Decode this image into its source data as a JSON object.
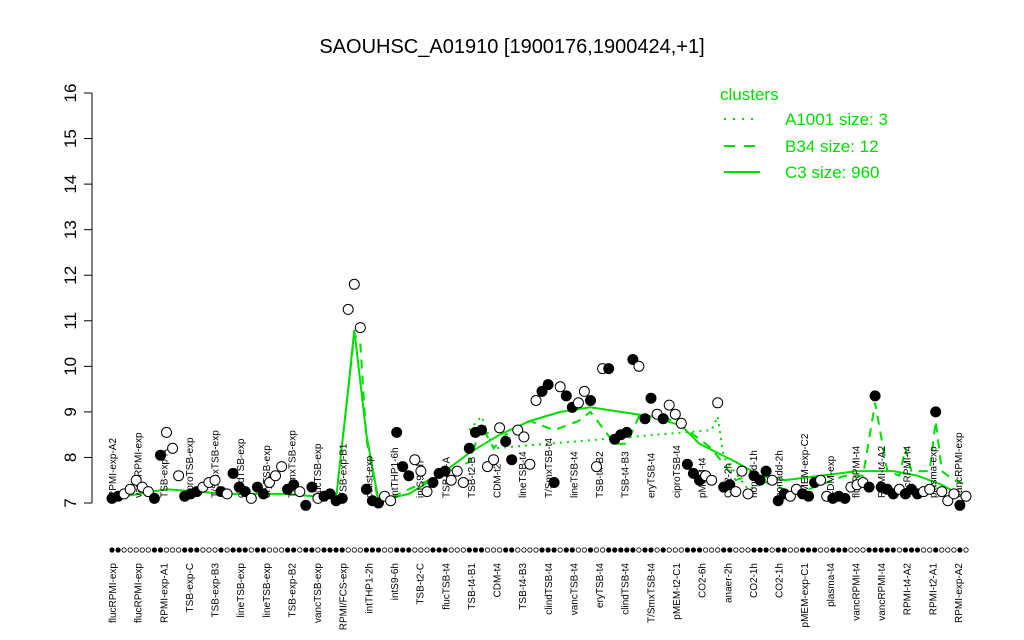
{
  "chart_data": {
    "type": "scatter",
    "title": "SAOUHSC_A01910 [1900176,1900424,+1]",
    "xlabel": "",
    "ylabel": "",
    "ylim": [
      7,
      16
    ],
    "yticks": [
      7,
      8,
      9,
      10,
      11,
      12,
      13,
      14,
      15,
      16
    ],
    "grid": false,
    "legend": {
      "title": "clusters",
      "position": "top-right",
      "entries": [
        {
          "label": "A1001 size: 3",
          "style": "dotted"
        },
        {
          "label": "B34 size: 12",
          "style": "dashed"
        },
        {
          "label": "C3 size: 960",
          "style": "solid"
        }
      ]
    },
    "colors": {
      "cluster_line": "#00dd00",
      "points": "#000000"
    },
    "x_tick_labels": [
      "flucRPMI-exp",
      "flucRPMI-exp",
      "RPMI-exp-A1",
      "TSB-exp-C",
      "TSB-exp-B3",
      "lineTSB-exp",
      "lineTSB-exp",
      "TSB-exp-B2",
      "vancTSB-exp",
      "RPMI/FCS-exp",
      "intTHP1-2h",
      "intS9-6h",
      "TSB-t2-C",
      "flucTSB-t4",
      "TSB-t4-B1",
      "CDM-t4",
      "TSB-t4-B3",
      "clindTSB-t4",
      "vancTSB-t4",
      "eryTSB-t4",
      "clindTSB-t4",
      "T/SmxTSB-t4",
      "pMEM-t2-C1",
      "CO2-6h",
      "anaer-2h",
      "CO2-1h",
      "CO2-1h",
      "pMEM-exp-C1",
      "plasma-t4",
      "vancRPMI-t4",
      "vancRPMI-t4",
      "RPMI-t4-A2",
      "RPMI-t2-A1",
      "RPMI-exp-A2"
    ],
    "point_labels": [
      "RPMI-exp-A2",
      "vancRPMI-exp",
      "TSB-exp-A",
      "ciproTSB-exp",
      "T/SmxTSB-exp",
      "clindTSB-exp",
      "eryTSB-exp",
      "T/SmxTSB-exp",
      "flucTSB-exp",
      "TSB-exp-B1",
      "colist-exp",
      "intTHP1-6h",
      "intS9-2h",
      "TSB-t4-A",
      "TSB-t2-B",
      "CDM-t2",
      "lineTSB-t4",
      "T/SmxTSB-t4",
      "lineTSB-t4",
      "TSB-t4-B2",
      "TSB-t4-B3",
      "eryTSB-t4",
      "ciproTSB-t4",
      "pMEM-t4",
      "CO2-2h",
      "nonadd-1h",
      "nonadd-2h",
      "pMEM-exp-C2",
      "CDM-exp",
      "flucRPMI-t4",
      "RPMI-t4-A2",
      "flucRPMI-t4",
      "plasma-exp",
      "vancRPMI-exp"
    ],
    "points": [
      {
        "x": 1,
        "y": 7.1,
        "f": 1
      },
      {
        "x": 2,
        "y": 7.15,
        "f": 1
      },
      {
        "x": 3,
        "y": 7.2,
        "f": 0
      },
      {
        "x": 4,
        "y": 7.3,
        "f": 0
      },
      {
        "x": 5,
        "y": 7.5,
        "f": 0
      },
      {
        "x": 6,
        "y": 7.35,
        "f": 0
      },
      {
        "x": 7,
        "y": 7.25,
        "f": 0
      },
      {
        "x": 8,
        "y": 7.1,
        "f": 1
      },
      {
        "x": 9,
        "y": 8.05,
        "f": 1
      },
      {
        "x": 10,
        "y": 8.55,
        "f": 0
      },
      {
        "x": 11,
        "y": 8.2,
        "f": 0
      },
      {
        "x": 12,
        "y": 7.6,
        "f": 0
      },
      {
        "x": 13,
        "y": 7.15,
        "f": 1
      },
      {
        "x": 14,
        "y": 7.2,
        "f": 1
      },
      {
        "x": 15,
        "y": 7.25,
        "f": 1
      },
      {
        "x": 16,
        "y": 7.35,
        "f": 0
      },
      {
        "x": 17,
        "y": 7.45,
        "f": 0
      },
      {
        "x": 18,
        "y": 7.5,
        "f": 0
      },
      {
        "x": 19,
        "y": 7.25,
        "f": 1
      },
      {
        "x": 20,
        "y": 7.2,
        "f": 0
      },
      {
        "x": 21,
        "y": 7.65,
        "f": 1
      },
      {
        "x": 22,
        "y": 7.35,
        "f": 1
      },
      {
        "x": 23,
        "y": 7.25,
        "f": 1
      },
      {
        "x": 24,
        "y": 7.1,
        "f": 0
      },
      {
        "x": 25,
        "y": 7.35,
        "f": 1
      },
      {
        "x": 26,
        "y": 7.2,
        "f": 1
      },
      {
        "x": 27,
        "y": 7.45,
        "f": 0
      },
      {
        "x": 28,
        "y": 7.6,
        "f": 0
      },
      {
        "x": 29,
        "y": 7.8,
        "f": 0
      },
      {
        "x": 30,
        "y": 7.3,
        "f": 1
      },
      {
        "x": 31,
        "y": 7.4,
        "f": 1
      },
      {
        "x": 32,
        "y": 7.25,
        "f": 0
      },
      {
        "x": 33,
        "y": 6.95,
        "f": 1
      },
      {
        "x": 34,
        "y": 7.35,
        "f": 1
      },
      {
        "x": 35,
        "y": 7.1,
        "f": 0
      },
      {
        "x": 36,
        "y": 7.15,
        "f": 1
      },
      {
        "x": 37,
        "y": 7.2,
        "f": 1
      },
      {
        "x": 38,
        "y": 7.05,
        "f": 1
      },
      {
        "x": 39,
        "y": 7.1,
        "f": 1
      },
      {
        "x": 40,
        "y": 11.25,
        "f": 0
      },
      {
        "x": 41,
        "y": 11.8,
        "f": 0
      },
      {
        "x": 42,
        "y": 10.85,
        "f": 0
      },
      {
        "x": 43,
        "y": 7.3,
        "f": 1
      },
      {
        "x": 44,
        "y": 7.05,
        "f": 1
      },
      {
        "x": 45,
        "y": 7.0,
        "f": 1
      },
      {
        "x": 46,
        "y": 7.15,
        "f": 0
      },
      {
        "x": 47,
        "y": 7.05,
        "f": 0
      },
      {
        "x": 48,
        "y": 8.55,
        "f": 1
      },
      {
        "x": 49,
        "y": 7.8,
        "f": 1
      },
      {
        "x": 50,
        "y": 7.6,
        "f": 1
      },
      {
        "x": 51,
        "y": 7.95,
        "f": 0
      },
      {
        "x": 52,
        "y": 7.7,
        "f": 0
      },
      {
        "x": 53,
        "y": 7.25,
        "f": 0
      },
      {
        "x": 54,
        "y": 7.45,
        "f": 1
      },
      {
        "x": 55,
        "y": 7.65,
        "f": 1
      },
      {
        "x": 56,
        "y": 7.7,
        "f": 1
      },
      {
        "x": 57,
        "y": 7.5,
        "f": 0
      },
      {
        "x": 58,
        "y": 7.7,
        "f": 0
      },
      {
        "x": 59,
        "y": 7.45,
        "f": 0
      },
      {
        "x": 60,
        "y": 8.2,
        "f": 1
      },
      {
        "x": 61,
        "y": 8.55,
        "f": 1
      },
      {
        "x": 62,
        "y": 8.6,
        "f": 1
      },
      {
        "x": 63,
        "y": 7.8,
        "f": 0
      },
      {
        "x": 64,
        "y": 7.95,
        "f": 0
      },
      {
        "x": 65,
        "y": 8.65,
        "f": 0
      },
      {
        "x": 66,
        "y": 8.35,
        "f": 1
      },
      {
        "x": 67,
        "y": 7.95,
        "f": 1
      },
      {
        "x": 68,
        "y": 8.6,
        "f": 0
      },
      {
        "x": 69,
        "y": 8.45,
        "f": 0
      },
      {
        "x": 70,
        "y": 7.85,
        "f": 0
      },
      {
        "x": 71,
        "y": 9.25,
        "f": 0
      },
      {
        "x": 72,
        "y": 9.45,
        "f": 1
      },
      {
        "x": 73,
        "y": 9.6,
        "f": 1
      },
      {
        "x": 74,
        "y": 7.45,
        "f": 1
      },
      {
        "x": 75,
        "y": 9.55,
        "f": 0
      },
      {
        "x": 76,
        "y": 9.35,
        "f": 1
      },
      {
        "x": 77,
        "y": 9.1,
        "f": 1
      },
      {
        "x": 78,
        "y": 9.2,
        "f": 0
      },
      {
        "x": 79,
        "y": 9.45,
        "f": 0
      },
      {
        "x": 80,
        "y": 9.25,
        "f": 1
      },
      {
        "x": 81,
        "y": 7.8,
        "f": 0
      },
      {
        "x": 82,
        "y": 9.95,
        "f": 0
      },
      {
        "x": 83,
        "y": 9.95,
        "f": 1
      },
      {
        "x": 84,
        "y": 8.4,
        "f": 1
      },
      {
        "x": 85,
        "y": 8.5,
        "f": 1
      },
      {
        "x": 86,
        "y": 8.55,
        "f": 1
      },
      {
        "x": 87,
        "y": 10.15,
        "f": 1
      },
      {
        "x": 88,
        "y": 10.0,
        "f": 0
      },
      {
        "x": 89,
        "y": 8.85,
        "f": 1
      },
      {
        "x": 90,
        "y": 9.3,
        "f": 1
      },
      {
        "x": 91,
        "y": 8.95,
        "f": 0
      },
      {
        "x": 92,
        "y": 8.85,
        "f": 1
      },
      {
        "x": 93,
        "y": 9.15,
        "f": 0
      },
      {
        "x": 94,
        "y": 8.95,
        "f": 0
      },
      {
        "x": 95,
        "y": 8.75,
        "f": 0
      },
      {
        "x": 96,
        "y": 7.85,
        "f": 1
      },
      {
        "x": 97,
        "y": 7.65,
        "f": 1
      },
      {
        "x": 98,
        "y": 7.5,
        "f": 1
      },
      {
        "x": 99,
        "y": 7.6,
        "f": 0
      },
      {
        "x": 100,
        "y": 7.5,
        "f": 0
      },
      {
        "x": 101,
        "y": 9.2,
        "f": 0
      },
      {
        "x": 102,
        "y": 7.35,
        "f": 1
      },
      {
        "x": 103,
        "y": 7.4,
        "f": 1
      },
      {
        "x": 104,
        "y": 7.25,
        "f": 0
      },
      {
        "x": 105,
        "y": 7.7,
        "f": 0
      },
      {
        "x": 106,
        "y": 7.2,
        "f": 0
      },
      {
        "x": 107,
        "y": 7.6,
        "f": 1
      },
      {
        "x": 108,
        "y": 7.5,
        "f": 1
      },
      {
        "x": 109,
        "y": 7.7,
        "f": 1
      },
      {
        "x": 110,
        "y": 7.5,
        "f": 0
      },
      {
        "x": 111,
        "y": 7.05,
        "f": 1
      },
      {
        "x": 112,
        "y": 7.2,
        "f": 1
      },
      {
        "x": 113,
        "y": 7.15,
        "f": 0
      },
      {
        "x": 114,
        "y": 7.3,
        "f": 0
      },
      {
        "x": 115,
        "y": 7.2,
        "f": 1
      },
      {
        "x": 116,
        "y": 7.15,
        "f": 1
      },
      {
        "x": 117,
        "y": 7.45,
        "f": 1
      },
      {
        "x": 118,
        "y": 7.5,
        "f": 0
      },
      {
        "x": 119,
        "y": 7.15,
        "f": 0
      },
      {
        "x": 120,
        "y": 7.1,
        "f": 1
      },
      {
        "x": 121,
        "y": 7.15,
        "f": 1
      },
      {
        "x": 122,
        "y": 7.1,
        "f": 1
      },
      {
        "x": 123,
        "y": 7.35,
        "f": 0
      },
      {
        "x": 124,
        "y": 7.4,
        "f": 0
      },
      {
        "x": 125,
        "y": 7.45,
        "f": 0
      },
      {
        "x": 126,
        "y": 7.35,
        "f": 1
      },
      {
        "x": 127,
        "y": 9.35,
        "f": 1
      },
      {
        "x": 128,
        "y": 7.35,
        "f": 1
      },
      {
        "x": 129,
        "y": 7.3,
        "f": 1
      },
      {
        "x": 130,
        "y": 7.2,
        "f": 1
      },
      {
        "x": 131,
        "y": 7.3,
        "f": 0
      },
      {
        "x": 132,
        "y": 7.2,
        "f": 1
      },
      {
        "x": 133,
        "y": 7.3,
        "f": 1
      },
      {
        "x": 134,
        "y": 7.2,
        "f": 1
      },
      {
        "x": 135,
        "y": 7.25,
        "f": 0
      },
      {
        "x": 136,
        "y": 7.3,
        "f": 0
      },
      {
        "x": 137,
        "y": 9.0,
        "f": 1
      },
      {
        "x": 138,
        "y": 7.25,
        "f": 0
      },
      {
        "x": 139,
        "y": 7.05,
        "f": 0
      },
      {
        "x": 140,
        "y": 7.2,
        "f": 0
      },
      {
        "x": 141,
        "y": 6.95,
        "f": 1
      },
      {
        "x": 142,
        "y": 7.15,
        "f": 0
      }
    ],
    "cluster_lines": {
      "C3": [
        [
          1,
          7.1
        ],
        [
          10,
          7.3
        ],
        [
          20,
          7.2
        ],
        [
          30,
          7.2
        ],
        [
          38,
          7.1
        ],
        [
          40,
          9.5
        ],
        [
          41,
          10.8
        ],
        [
          43,
          8.5
        ],
        [
          45,
          7.05
        ],
        [
          50,
          7.2
        ],
        [
          55,
          7.6
        ],
        [
          60,
          8.1
        ],
        [
          65,
          8.5
        ],
        [
          70,
          8.8
        ],
        [
          75,
          9.0
        ],
        [
          80,
          9.1
        ],
        [
          85,
          9.0
        ],
        [
          90,
          8.9
        ],
        [
          95,
          8.7
        ],
        [
          98,
          8.3
        ],
        [
          104,
          7.9
        ],
        [
          108,
          7.6
        ],
        [
          112,
          7.5
        ],
        [
          118,
          7.6
        ],
        [
          124,
          7.7
        ],
        [
          130,
          7.7
        ],
        [
          134,
          7.6
        ],
        [
          138,
          7.4
        ],
        [
          142,
          7.1
        ]
      ],
      "B34": [
        [
          38,
          7.1
        ],
        [
          40,
          9.5
        ],
        [
          41,
          10.7
        ],
        [
          42,
          10.5
        ],
        [
          43,
          8.4
        ],
        [
          45,
          7.0
        ],
        [
          60,
          7.9
        ],
        [
          62,
          8.7
        ],
        [
          64,
          8.2
        ],
        [
          66,
          8.5
        ],
        [
          68,
          8.6
        ],
        [
          70,
          8.8
        ],
        [
          74,
          8.6
        ],
        [
          78,
          8.8
        ],
        [
          80,
          9.0
        ],
        [
          84,
          8.3
        ],
        [
          86,
          8.3
        ],
        [
          88,
          8.9
        ],
        [
          92,
          8.9
        ],
        [
          95,
          8.7
        ],
        [
          98,
          8.4
        ],
        [
          100,
          8.2
        ],
        [
          104,
          7.5
        ],
        [
          106,
          7.6
        ],
        [
          110,
          7.4
        ],
        [
          114,
          7.2
        ],
        [
          118,
          7.4
        ],
        [
          122,
          7.6
        ],
        [
          125,
          7.6
        ],
        [
          127,
          9.2
        ],
        [
          129,
          7.7
        ],
        [
          131,
          7.6
        ],
        [
          132,
          8.2
        ],
        [
          133,
          7.7
        ],
        [
          136,
          7.7
        ],
        [
          137,
          8.8
        ],
        [
          138,
          7.7
        ],
        [
          140,
          7.5
        ],
        [
          142,
          7.4
        ]
      ],
      "A1001": [
        [
          60,
          8.6
        ],
        [
          62,
          8.9
        ],
        [
          64,
          8.2
        ],
        [
          100,
          8.6
        ],
        [
          101,
          8.9
        ],
        [
          102,
          8.0
        ],
        [
          106,
          7.3
        ],
        [
          108,
          7.4
        ]
      ]
    }
  }
}
